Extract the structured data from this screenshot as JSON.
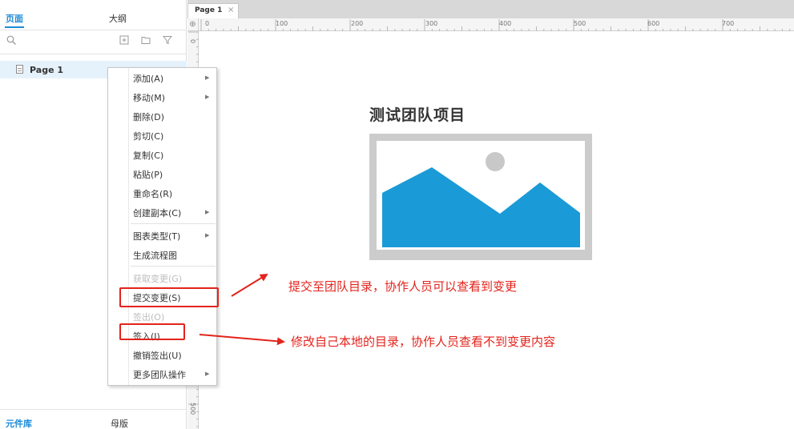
{
  "left_panel": {
    "tabs": {
      "pages": "页面",
      "outline": "大纲"
    },
    "toolbar": {
      "search": "search-icon",
      "add_page": "add-page-icon",
      "add_folder": "folder-icon",
      "filter": "filter-icon"
    },
    "pages": [
      {
        "label": "Page 1"
      }
    ],
    "bottom_tabs": {
      "library": "元件库",
      "masters": "母版"
    }
  },
  "document": {
    "tab_label": "Page 1",
    "close_glyph": "×",
    "ruler_h": [
      "0",
      "100",
      "200",
      "300",
      "400",
      "500",
      "600",
      "700"
    ],
    "ruler_v": [
      "0",
      "500"
    ],
    "ruler_corner_glyph": "⊕"
  },
  "canvas": {
    "title": "测试团队项目",
    "image_colors": {
      "frame": "#cccccc",
      "mountain": "#1a9ad6",
      "sun": "#c8c8c8"
    }
  },
  "context_menu": {
    "items": [
      {
        "label": "添加(A)",
        "submenu": true,
        "disabled": false
      },
      {
        "label": "移动(M)",
        "submenu": true,
        "disabled": false
      },
      {
        "label": "删除(D)",
        "submenu": false,
        "disabled": false
      },
      {
        "label": "剪切(C)",
        "submenu": false,
        "disabled": false
      },
      {
        "label": "复制(C)",
        "submenu": false,
        "disabled": false
      },
      {
        "label": "粘贴(P)",
        "submenu": false,
        "disabled": false
      },
      {
        "label": "重命名(R)",
        "submenu": false,
        "disabled": false
      },
      {
        "label": "创建副本(C)",
        "submenu": true,
        "disabled": false
      },
      {
        "label": "图表类型(T)",
        "submenu": true,
        "disabled": false
      },
      {
        "label": "生成流程图",
        "submenu": false,
        "disabled": false
      },
      {
        "label": "获取变更(G)",
        "submenu": false,
        "disabled": true
      },
      {
        "label": "提交变更(S)",
        "submenu": false,
        "disabled": false
      },
      {
        "label": "签出(O)",
        "submenu": false,
        "disabled": true
      },
      {
        "label": "签入(I)",
        "submenu": false,
        "disabled": false
      },
      {
        "label": "撤销签出(U)",
        "submenu": false,
        "disabled": false
      },
      {
        "label": "更多团队操作",
        "submenu": true,
        "disabled": false
      }
    ],
    "submenu_glyph": "▶"
  },
  "annotations": {
    "submit": "提交至团队目录，协作人员可以查看到变更",
    "checkin": "修改自己本地的目录，协作人员查看不到变更内容",
    "color": "#e3231c"
  },
  "colors": {
    "accent": "#1c8bd8",
    "selected_row": "#e6f2fb"
  }
}
